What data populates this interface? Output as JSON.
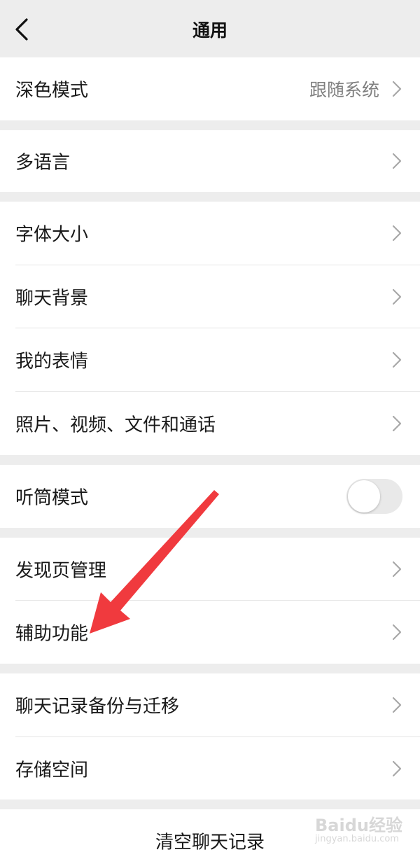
{
  "nav": {
    "title": "通用",
    "back_icon": "chevron-left-icon"
  },
  "settings": {
    "dark_mode": {
      "label": "深色模式",
      "value": "跟随系统"
    },
    "multi_language": {
      "label": "多语言"
    },
    "font_size": {
      "label": "字体大小"
    },
    "chat_background": {
      "label": "聊天背景"
    },
    "my_stickers": {
      "label": "我的表情"
    },
    "photos_videos_files_calls": {
      "label": "照片、视频、文件和通话"
    },
    "earpiece_mode": {
      "label": "听筒模式",
      "enabled": false
    },
    "discover_page_management": {
      "label": "发现页管理"
    },
    "accessibility": {
      "label": "辅助功能"
    },
    "chat_history_backup": {
      "label": "聊天记录备份与迁移"
    },
    "storage": {
      "label": "存储空间"
    },
    "clear_chat_history": {
      "label": "清空聊天记录"
    }
  },
  "annotation": {
    "arrow_color": "#f03a3e"
  },
  "watermark": {
    "logo_text": "Baidu经验",
    "sub_text": "jingyan.baidu.com"
  },
  "colors": {
    "background": "#ededed",
    "cell_background": "#ffffff",
    "text_primary": "#191919",
    "text_secondary": "#7f7f7f",
    "divider": "#e5e5e5"
  }
}
